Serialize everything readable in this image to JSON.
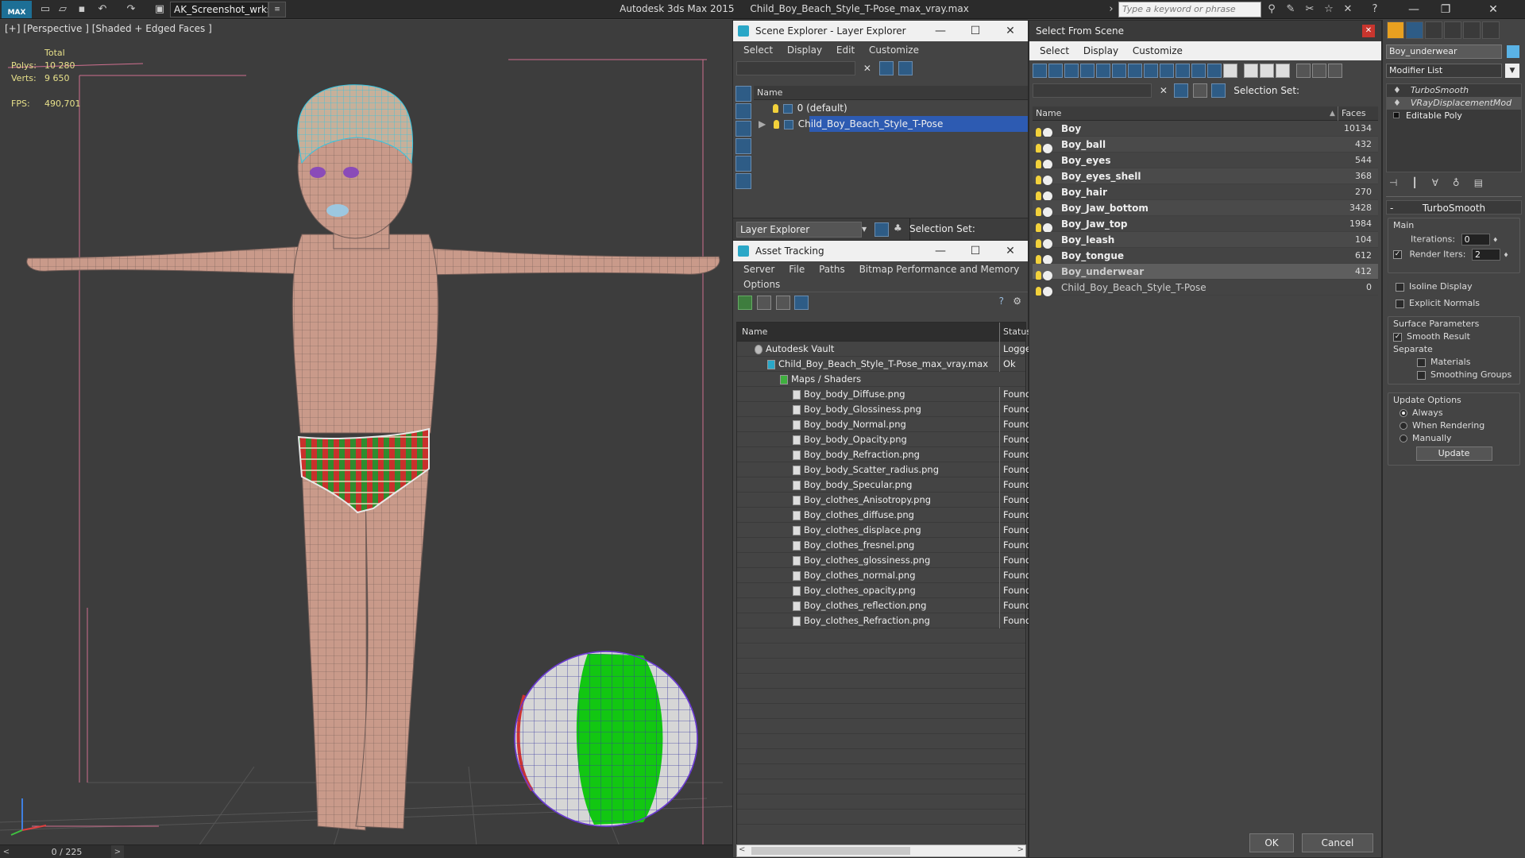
{
  "titlebar": {
    "workspace": "AK_Screenshot_wrksp",
    "app_name": "Autodesk 3ds Max  2015",
    "file_title": "Child_Boy_Beach_Style_T-Pose_max_vray.max",
    "search_placeholder": "Type a keyword or phrase"
  },
  "viewport": {
    "label": "[+] [Perspective ] [Shaded + Edged Faces ]",
    "stats": {
      "total_label": "Total",
      "polys_label": "Polys:",
      "polys_value": "10 280",
      "verts_label": "Verts:",
      "verts_value": "9 650",
      "fps_label": "FPS:",
      "fps_value": "490,701"
    },
    "timeline_value": "0 / 225"
  },
  "scene_explorer": {
    "title": "Scene Explorer - Layer Explorer",
    "menu": [
      "Select",
      "Display",
      "Edit",
      "Customize"
    ],
    "column_name": "Name",
    "layers": [
      {
        "name": "0 (default)",
        "selected": false
      },
      {
        "name": "Child_Boy_Beach_Style_T-Pose",
        "selected": true
      }
    ],
    "footer_dropdown": "Layer Explorer",
    "footer_selection_label": "Selection Set:"
  },
  "asset_tracking": {
    "title": "Asset Tracking",
    "menu": [
      "Server",
      "File",
      "Paths",
      "Bitmap Performance and Memory"
    ],
    "menu2": "Options",
    "col_name": "Name",
    "col_status": "Status",
    "rows": [
      {
        "name": "Autodesk Vault",
        "status": "Logged",
        "indent": 0,
        "kind": "vault"
      },
      {
        "name": "Child_Boy_Beach_Style_T-Pose_max_vray.max",
        "status": "Ok",
        "indent": 1,
        "kind": "max"
      },
      {
        "name": "Maps / Shaders",
        "status": "",
        "indent": 2,
        "kind": "folder"
      },
      {
        "name": "Boy_body_Diffuse.png",
        "status": "Found",
        "indent": 3,
        "kind": "file"
      },
      {
        "name": "Boy_body_Glossiness.png",
        "status": "Found",
        "indent": 3,
        "kind": "file"
      },
      {
        "name": "Boy_body_Normal.png",
        "status": "Found",
        "indent": 3,
        "kind": "file"
      },
      {
        "name": "Boy_body_Opacity.png",
        "status": "Found",
        "indent": 3,
        "kind": "file"
      },
      {
        "name": "Boy_body_Refraction.png",
        "status": "Found",
        "indent": 3,
        "kind": "file"
      },
      {
        "name": "Boy_body_Scatter_radius.png",
        "status": "Found",
        "indent": 3,
        "kind": "file"
      },
      {
        "name": "Boy_body_Specular.png",
        "status": "Found",
        "indent": 3,
        "kind": "file"
      },
      {
        "name": "Boy_clothes_Anisotropy.png",
        "status": "Found",
        "indent": 3,
        "kind": "file"
      },
      {
        "name": "Boy_clothes_diffuse.png",
        "status": "Found",
        "indent": 3,
        "kind": "file"
      },
      {
        "name": "Boy_clothes_displace.png",
        "status": "Found",
        "indent": 3,
        "kind": "file"
      },
      {
        "name": "Boy_clothes_fresnel.png",
        "status": "Found",
        "indent": 3,
        "kind": "file"
      },
      {
        "name": "Boy_clothes_glossiness.png",
        "status": "Found",
        "indent": 3,
        "kind": "file"
      },
      {
        "name": "Boy_clothes_normal.png",
        "status": "Found",
        "indent": 3,
        "kind": "file"
      },
      {
        "name": "Boy_clothes_opacity.png",
        "status": "Found",
        "indent": 3,
        "kind": "file"
      },
      {
        "name": "Boy_clothes_reflection.png",
        "status": "Found",
        "indent": 3,
        "kind": "file"
      },
      {
        "name": "Boy_clothes_Refraction.png",
        "status": "Found",
        "indent": 3,
        "kind": "file"
      }
    ]
  },
  "select_from_scene": {
    "title": "Select From Scene",
    "menu": [
      "Select",
      "Display",
      "Customize"
    ],
    "selection_set_label": "Selection Set:",
    "col_name": "Name",
    "col_faces": "Faces",
    "objects": [
      {
        "name": "Boy",
        "faces": "10134"
      },
      {
        "name": "Boy_ball",
        "faces": "432"
      },
      {
        "name": "Boy_eyes",
        "faces": "544"
      },
      {
        "name": "Boy_eyes_shell",
        "faces": "368"
      },
      {
        "name": "Boy_hair",
        "faces": "270"
      },
      {
        "name": "Boy_Jaw_bottom",
        "faces": "3428"
      },
      {
        "name": "Boy_Jaw_top",
        "faces": "1984"
      },
      {
        "name": "Boy_leash",
        "faces": "104"
      },
      {
        "name": "Boy_tongue",
        "faces": "612"
      },
      {
        "name": "Boy_underwear",
        "faces": "412"
      },
      {
        "name": "Child_Boy_Beach_Style_T-Pose",
        "faces": "0"
      }
    ],
    "ok_label": "OK",
    "cancel_label": "Cancel"
  },
  "command_panel": {
    "object_name": "Boy_underwear",
    "modifier_list": "Modifier List",
    "stack": [
      "TurboSmooth",
      "VRayDisplacementMod",
      "Editable Poly"
    ],
    "rollout_title": "TurboSmooth",
    "main_label": "Main",
    "iterations_label": "Iterations:",
    "iterations_value": "0",
    "render_iters_label": "Render Iters:",
    "render_iters_value": "2",
    "isoline_label": "Isoline Display",
    "explicit_normals_label": "Explicit Normals",
    "surface_params_label": "Surface Parameters",
    "smooth_result_label": "Smooth Result",
    "separate_label": "Separate",
    "materials_label": "Materials",
    "smoothing_groups_label": "Smoothing Groups",
    "update_options_label": "Update Options",
    "always_label": "Always",
    "when_rendering_label": "When Rendering",
    "manually_label": "Manually",
    "update_button": "Update"
  },
  "colors": {
    "accent": "#2d5bb2",
    "stats_text": "#e7e08a",
    "skin": "#c99a8a",
    "ball_green": "#12c712"
  }
}
